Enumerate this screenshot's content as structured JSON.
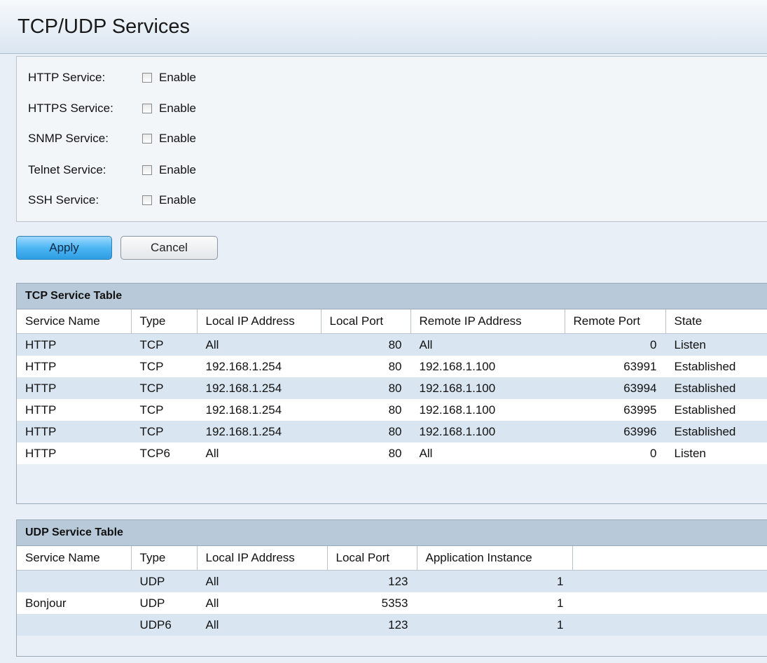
{
  "page": {
    "title": "TCP/UDP Services"
  },
  "services": [
    {
      "label": "HTTP Service:",
      "checked": false,
      "option": "Enable"
    },
    {
      "label": "HTTPS Service:",
      "checked": false,
      "option": "Enable"
    },
    {
      "label": "SNMP Service:",
      "checked": false,
      "option": "Enable"
    },
    {
      "label": "Telnet Service:",
      "checked": false,
      "option": "Enable"
    },
    {
      "label": "SSH Service:",
      "checked": false,
      "option": "Enable"
    }
  ],
  "buttons": {
    "apply": "Apply",
    "cancel": "Cancel"
  },
  "tcp_table": {
    "caption": "TCP Service Table",
    "columns": [
      "Service Name",
      "Type",
      "Local IP Address",
      "Local Port",
      "Remote IP Address",
      "Remote Port",
      "State"
    ],
    "rows": [
      [
        "HTTP",
        "TCP",
        "All",
        "80",
        "All",
        "0",
        "Listen"
      ],
      [
        "HTTP",
        "TCP",
        "192.168.1.254",
        "80",
        "192.168.1.100",
        "63991",
        "Established"
      ],
      [
        "HTTP",
        "TCP",
        "192.168.1.254",
        "80",
        "192.168.1.100",
        "63994",
        "Established"
      ],
      [
        "HTTP",
        "TCP",
        "192.168.1.254",
        "80",
        "192.168.1.100",
        "63995",
        "Established"
      ],
      [
        "HTTP",
        "TCP",
        "192.168.1.254",
        "80",
        "192.168.1.100",
        "63996",
        "Established"
      ],
      [
        "HTTP",
        "TCP6",
        "All",
        "80",
        "All",
        "0",
        "Listen"
      ]
    ]
  },
  "udp_table": {
    "caption": "UDP Service Table",
    "columns": [
      "Service Name",
      "Type",
      "Local IP Address",
      "Local Port",
      "Application Instance",
      ""
    ],
    "rows": [
      [
        "",
        "UDP",
        "All",
        "123",
        "1",
        ""
      ],
      [
        "Bonjour",
        "UDP",
        "All",
        "5353",
        "1",
        ""
      ],
      [
        "",
        "UDP6",
        "All",
        "123",
        "1",
        ""
      ]
    ]
  }
}
